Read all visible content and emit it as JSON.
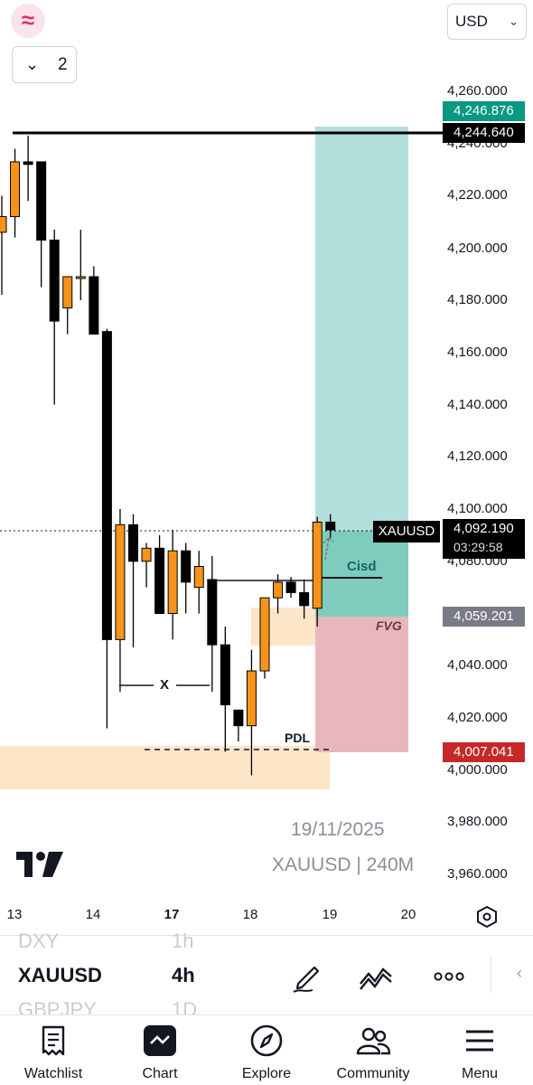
{
  "header": {
    "logo_glyph": "≈",
    "currency": "USD",
    "layers_count": "2"
  },
  "y_axis": {
    "ticks": [
      "4,260.000",
      "4,240.000",
      "4,220.000",
      "4,200.000",
      "4,180.000",
      "4,160.000",
      "4,140.000",
      "4,120.000",
      "4,100.000",
      "4,080.000",
      "4,040.000",
      "4,020.000",
      "4,000.000",
      "3,980.000",
      "3,960.000"
    ]
  },
  "price_labels": {
    "target": "4,246.876",
    "black_line": "4,244.640",
    "current_symbol": "XAUUSD",
    "current_price": "4,092.190",
    "countdown": "03:29:58",
    "entry": "4,059.201",
    "stop": "4,007.041"
  },
  "annotations": {
    "cisd": "Cisd",
    "fvg": "FVG",
    "x_mark": "X",
    "pdl": "PDL"
  },
  "watermark": {
    "date": "19/11/2025",
    "symbol_tf": "XAUUSD | 240M"
  },
  "x_axis": {
    "ticks": [
      "13",
      "14",
      "17",
      "18",
      "19",
      "20"
    ],
    "bold_tick": "17"
  },
  "watchlist": {
    "rows": [
      {
        "symbol": "DXY",
        "tf": "1h"
      },
      {
        "symbol": "XAUUSD",
        "tf": "4h"
      },
      {
        "symbol": "GBPJPY",
        "tf": "1D"
      }
    ]
  },
  "bottom_nav": {
    "items": [
      "Watchlist",
      "Chart",
      "Explore",
      "Community",
      "Menu"
    ]
  },
  "colors": {
    "bull": "#f7931a",
    "bear": "#000000",
    "target_zone": "#b2dfdb",
    "stop_zone": "#e8b7bd",
    "fvg_zone": "#fde5c8",
    "target_label": "#089981",
    "entry_label": "#787b86",
    "stop_label": "#c62828"
  },
  "chart_data": {
    "type": "candlestick",
    "symbol": "XAUUSD",
    "timeframe": "240M",
    "ylim": [
      3950,
      4270
    ],
    "candles": [
      {
        "o": 4206,
        "h": 4220,
        "l": 4182,
        "c": 4212
      },
      {
        "o": 4212,
        "h": 4238,
        "l": 4204,
        "c": 4233
      },
      {
        "o": 4233,
        "h": 4243,
        "l": 4218,
        "c": 4232
      },
      {
        "o": 4233,
        "h": 4232,
        "l": 4185,
        "c": 4203
      },
      {
        "o": 4203,
        "h": 4207,
        "l": 4140,
        "c": 4172
      },
      {
        "o": 4177,
        "h": 4188,
        "l": 4167,
        "c": 4189
      },
      {
        "o": 4189,
        "h": 4207,
        "l": 4180,
        "c": 4189
      },
      {
        "o": 4189,
        "h": 4193,
        "l": 4167,
        "c": 4167
      },
      {
        "o": 4168,
        "h": 4169,
        "l": 4016,
        "c": 4050
      },
      {
        "o": 4050,
        "h": 4100,
        "l": 4030,
        "c": 4094
      },
      {
        "o": 4094,
        "h": 4098,
        "l": 4047,
        "c": 4080
      },
      {
        "o": 4080,
        "h": 4087,
        "l": 4070,
        "c": 4085
      },
      {
        "o": 4085,
        "h": 4090,
        "l": 4060,
        "c": 4060
      },
      {
        "o": 4060,
        "h": 4092,
        "l": 4050,
        "c": 4084
      },
      {
        "o": 4084,
        "h": 4087,
        "l": 4060,
        "c": 4072
      },
      {
        "o": 4070,
        "h": 4084,
        "l": 4060,
        "c": 4078
      },
      {
        "o": 4073,
        "h": 4082,
        "l": 4030,
        "c": 4048
      },
      {
        "o": 4048,
        "h": 4055,
        "l": 4007,
        "c": 4025
      },
      {
        "o": 4023,
        "h": 4023,
        "l": 4011,
        "c": 4017
      },
      {
        "o": 4017,
        "h": 4046,
        "l": 3998,
        "c": 4038
      },
      {
        "o": 4038,
        "h": 4065,
        "l": 4035,
        "c": 4066
      },
      {
        "o": 4066,
        "h": 4075,
        "l": 4060,
        "c": 4072
      },
      {
        "o": 4072,
        "h": 4074,
        "l": 4066,
        "c": 4068
      },
      {
        "o": 4068,
        "h": 4073,
        "l": 4058,
        "c": 4063
      },
      {
        "o": 4062,
        "h": 4097,
        "l": 4055,
        "c": 4095
      },
      {
        "o": 4095,
        "h": 4098,
        "l": 4089,
        "c": 4092
      }
    ]
  }
}
